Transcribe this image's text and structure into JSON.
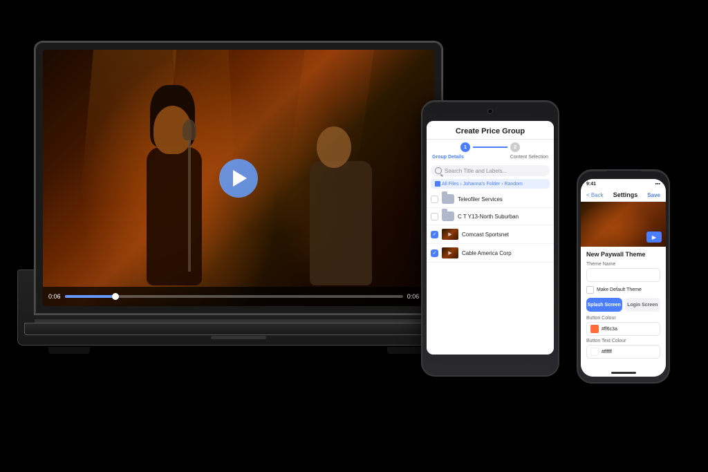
{
  "scene": {
    "background": "#000000"
  },
  "laptop": {
    "video": {
      "progress_percent": "15",
      "time_current": "0:06",
      "time_total": "0:06"
    }
  },
  "tablet": {
    "title": "Create Price Group",
    "stepper": {
      "step1_label": "Group Details",
      "step2_label": "Content Selection",
      "step1_number": "1",
      "step2_number": "2"
    },
    "search_placeholder": "Search Title and Labels...",
    "breadcrumb": "All Files › Johanna's Folder › Random",
    "files": [
      {
        "name": "Teleofiler Services",
        "type": "folder",
        "checked": false
      },
      {
        "name": "C T Y13-North Suburban",
        "type": "folder",
        "checked": false
      },
      {
        "name": "Comcast Sportsnet",
        "type": "video",
        "checked": true
      },
      {
        "name": "Cable America Corp",
        "type": "video",
        "checked": true
      }
    ]
  },
  "phone": {
    "status_time": "9:41",
    "header_back": "< Back",
    "header_title": "Settings",
    "header_save": "Save",
    "section_title": "New Paywall Theme",
    "theme_name_label": "Theme Name",
    "theme_name_value": "",
    "default_checkbox_label": "Make Default Theme",
    "tab_splash": "Splash Screen",
    "tab_login": "Login Screen",
    "button_colour_label": "Button Colour",
    "button_colour_value": "#ff6c3a",
    "button_text_colour_label": "Button Text Colour",
    "button_text_colour_value": "#ffffff"
  }
}
